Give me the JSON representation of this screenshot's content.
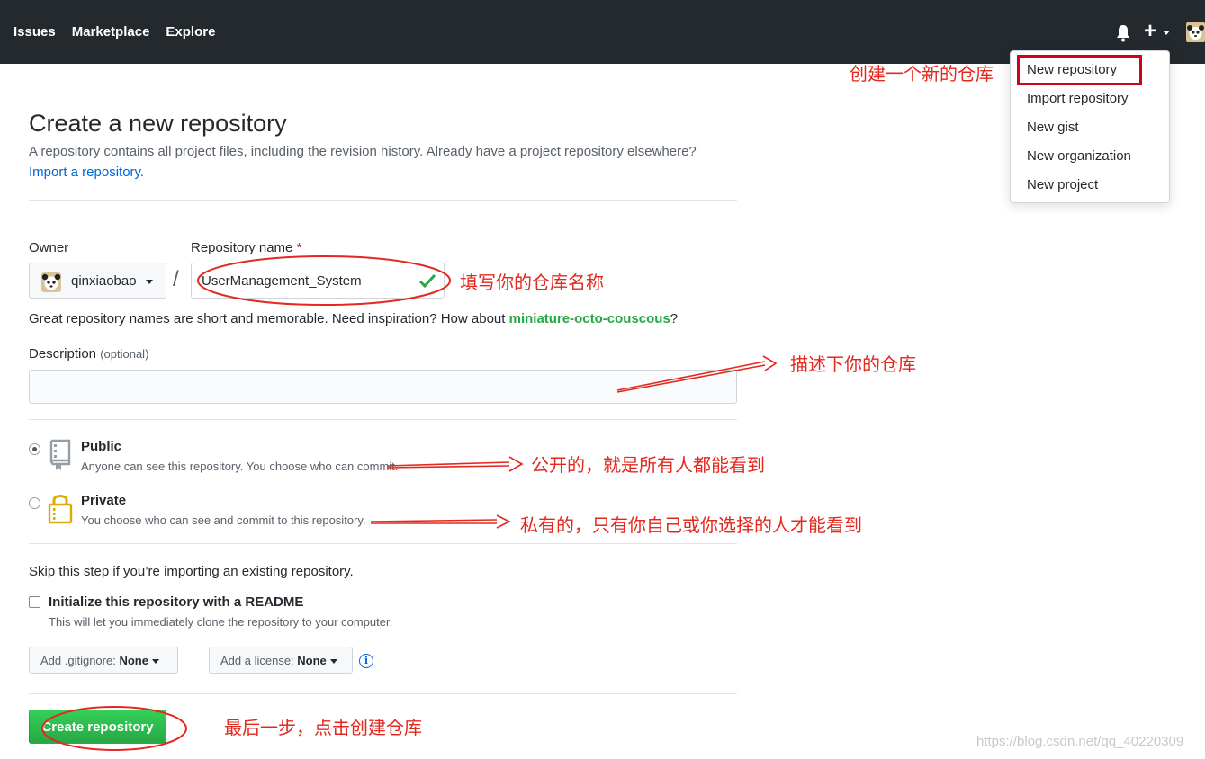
{
  "nav": {
    "issues": "Issues",
    "marketplace": "Marketplace",
    "explore": "Explore"
  },
  "dropdown": {
    "items": [
      "New repository",
      "Import repository",
      "New gist",
      "New organization",
      "New project"
    ]
  },
  "page": {
    "title": "Create a new repository",
    "subtitle": "A repository contains all project files, including the revision history. Already have a project repository elsewhere?",
    "import_link": "Import a repository."
  },
  "form": {
    "owner_label": "Owner",
    "repo_label": "Repository name",
    "required_mark": "*",
    "owner_value": "qinxiaobao",
    "slash": "/",
    "repo_value": "UserManagement_System",
    "hint_prefix": "Great repository names are short and memorable. Need inspiration? How about ",
    "hint_suggestion": "miniature-octo-couscous",
    "hint_suffix": "?",
    "description_label": "Description",
    "description_optional": "(optional)",
    "description_value": "",
    "public_title": "Public",
    "public_note": "Anyone can see this repository. You choose who can commit.",
    "private_title": "Private",
    "private_note": "You choose who can see and commit to this repository.",
    "visibility_selected": "Public",
    "skip_text": "Skip this step if you’re importing an existing repository.",
    "init_label": "Initialize this repository with a README",
    "init_note": "This will let you immediately clone the repository to your computer.",
    "init_checked": false,
    "gitignore_prefix": "Add .gitignore: ",
    "gitignore_value": "None",
    "license_prefix": "Add a license: ",
    "license_value": "None",
    "info_glyph": "i",
    "create_button": "Create repository"
  },
  "annotations": {
    "new_repo": "创建一个新的仓库",
    "repo_name": "填写你的仓库名称",
    "description": "描述下你的仓库",
    "public": "公开的，就是所有人都能看到",
    "private": "私有的，只有你自己或你选择的人才能看到",
    "create": "最后一步，点击创建仓库"
  },
  "watermark": "https://blog.csdn.net/qq_40220309",
  "colors": {
    "accent": "#0366d6",
    "success": "#28a745",
    "annotation": "#e3281e",
    "header": "#24292e"
  }
}
